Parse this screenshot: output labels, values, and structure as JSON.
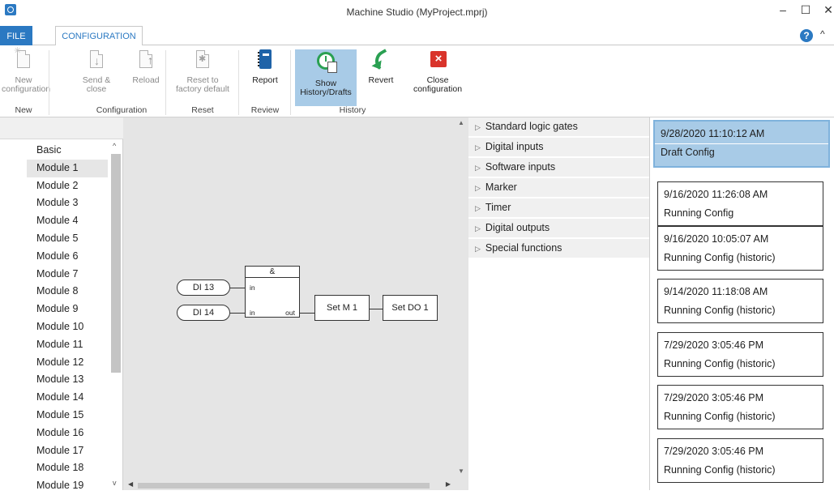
{
  "window": {
    "title": "Machine Studio (MyProject.mprj)",
    "minimize": "–",
    "maximize": "☐",
    "close": "✕"
  },
  "tabs": {
    "file": "FILE",
    "configuration": "CONFIGURATION"
  },
  "help": "?",
  "collapse": "^",
  "ribbon": {
    "new": {
      "l1": "New",
      "l2": "configuration",
      "group": "New"
    },
    "send": {
      "l1": "Send &",
      "l2": "close"
    },
    "reload": {
      "l1": "Reload",
      "l2": ""
    },
    "config_group": "Configuration",
    "reset": {
      "l1": "Reset to",
      "l2": "factory default",
      "group": "Reset"
    },
    "report": {
      "l1": "Report",
      "l2": "",
      "group": "Review"
    },
    "show_history": {
      "l1": "Show",
      "l2": "History/Drafts"
    },
    "revert": {
      "l1": "Revert",
      "l2": ""
    },
    "close_config": {
      "l1": "Close",
      "l2": "configuration"
    },
    "history_group": "History"
  },
  "modules": [
    "Basic",
    "Module 1",
    "Module 2",
    "Module 3",
    "Module 4",
    "Module 5",
    "Module 6",
    "Module 7",
    "Module 8",
    "Module 9",
    "Module 10",
    "Module 11",
    "Module 12",
    "Module 13",
    "Module 14",
    "Module 15",
    "Module 16",
    "Module 17",
    "Module 18",
    "Module 19"
  ],
  "selected_module": "Module 1",
  "diagram": {
    "in1": "DI 13",
    "in2": "DI 14",
    "gate": "&",
    "pin_in1": "in",
    "pin_in2": "in",
    "pin_out": "out",
    "block1": "Set M 1",
    "block2": "Set DO 1"
  },
  "toolbox": [
    "Standard logic gates",
    "Digital inputs",
    "Software inputs",
    "Marker",
    "Timer",
    "Digital outputs",
    "Special functions"
  ],
  "history": [
    {
      "date": "9/28/2020 11:10:12 AM",
      "status": "Draft Config",
      "selected": true
    },
    {
      "date": "9/16/2020 11:26:08 AM",
      "status": "Running Config"
    },
    {
      "date": "9/16/2020 10:05:07 AM",
      "status": "Running Config (historic)"
    },
    {
      "date": "9/14/2020 11:18:08 AM",
      "status": "Running Config (historic)"
    },
    {
      "date": "7/29/2020 3:05:46 PM",
      "status": "Running Config (historic)"
    },
    {
      "date": "7/29/2020 3:05:46 PM",
      "status": "Running Config (historic)"
    },
    {
      "date": "7/29/2020 3:05:46 PM",
      "status": "Running Config (historic)"
    }
  ]
}
